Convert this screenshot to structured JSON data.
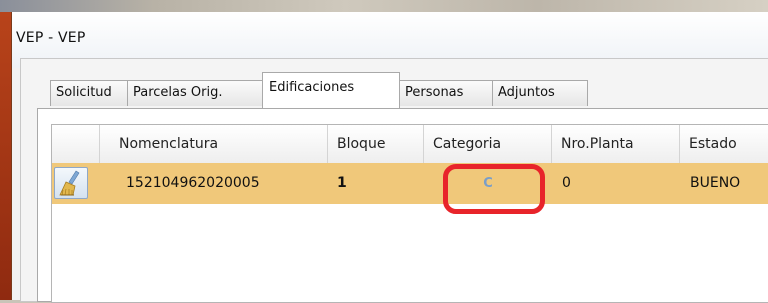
{
  "window": {
    "title": "VEP  -  VEP"
  },
  "tabs": [
    {
      "label": "Solicitud"
    },
    {
      "label": "Parcelas Orig."
    },
    {
      "label": "Edificaciones"
    },
    {
      "label": "Personas"
    },
    {
      "label": "Adjuntos"
    }
  ],
  "active_tab": "Edificaciones",
  "grid": {
    "columns": [
      "",
      "Nomenclatura",
      "Bloque",
      "Categoria",
      "Nro.Planta",
      "Estado"
    ],
    "rows": [
      {
        "selected": true,
        "action_icon": "broom-icon",
        "nomenclatura": "152104962020005",
        "bloque": "1",
        "categoria": "C",
        "nro_planta": "0",
        "estado": "BUENO"
      }
    ]
  },
  "colors": {
    "selected_row": "#f0c87a",
    "highlight": "#e8242a",
    "category_text": "#7a9ec8"
  }
}
